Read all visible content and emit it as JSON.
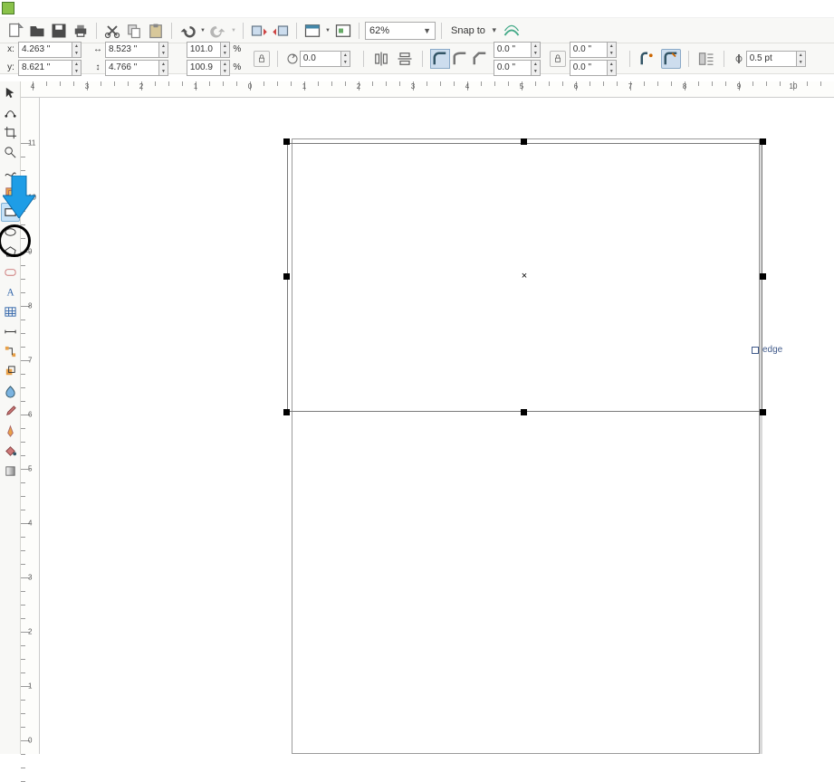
{
  "coords": {
    "x_label": "x:",
    "y_label": "y:",
    "x": "4.263 \"",
    "y": "8.621 \"",
    "w": "8.523 \"",
    "h": "4.766 \""
  },
  "scale": {
    "sx": "101.0",
    "sy": "100.9",
    "pct": "%"
  },
  "rotate": "0.0",
  "zoom_value": "62%",
  "snap_label": "Snap to",
  "offset1": "0.0 \"",
  "offset2": "0.0 \"",
  "offset3": "0.0 \"",
  "offset4": "0.0 \"",
  "stroke_width": "0.5 pt",
  "edge_label": "edge",
  "ruler_labels_h": [
    "4",
    "3",
    "2",
    "1",
    "0",
    "1",
    "2",
    "3",
    "4",
    "5",
    "6",
    "7",
    "8",
    "9",
    "10"
  ],
  "ruler_labels_v": [
    "11",
    "10",
    "9",
    "8",
    "7",
    "6",
    "5",
    "4",
    "3",
    "2",
    "1",
    "0"
  ]
}
